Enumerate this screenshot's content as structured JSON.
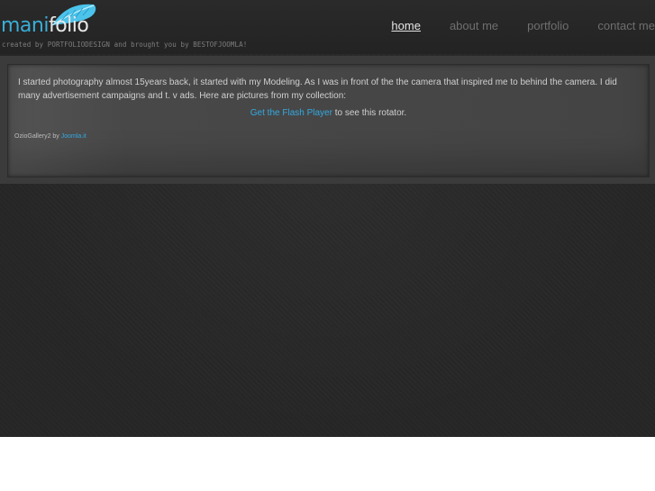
{
  "logo": {
    "part1": "mani",
    "part2": "folio",
    "accent_color": "#3aaed8",
    "icon": "feather-icon"
  },
  "credit": "created by PORTFOLIODESIGN and brought you by BESTOFJOOMLA!",
  "nav": {
    "items": [
      {
        "label": "home",
        "active": true
      },
      {
        "label": "about me",
        "active": false
      },
      {
        "label": "portfolio",
        "active": false
      },
      {
        "label": "contact me",
        "active": false
      }
    ]
  },
  "content": {
    "intro": "I started photography almost 15years back, it started with my Modeling. As I was in front of the the camera that inspired me to behind the camera. I did many advertisement campaigns and t. v ads. Here are pictures from my collection:",
    "flash_link": "Get the Flash Player",
    "flash_suffix": " to see this rotator.",
    "gallery_prefix": "OzioGallery2 by ",
    "gallery_link": "Joomla.it"
  },
  "colors": {
    "link": "#34a9e0",
    "background": "#262626",
    "panel": "#484848"
  }
}
